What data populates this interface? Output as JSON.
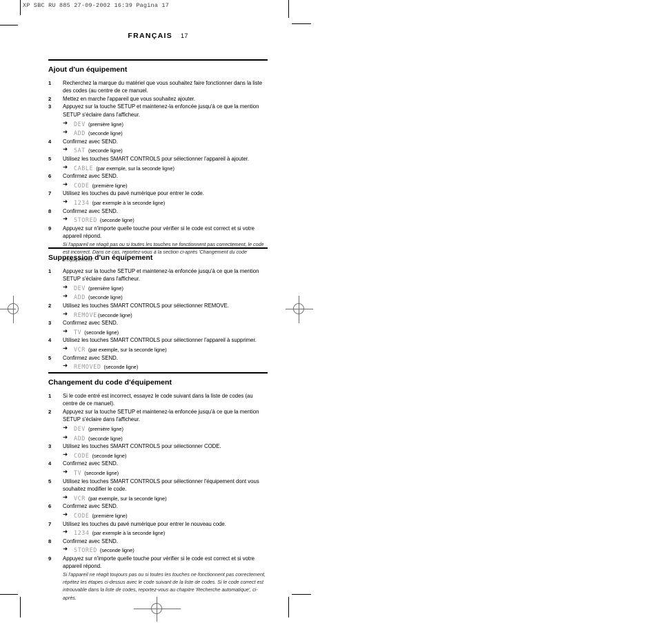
{
  "film_slug": "XP SBC RU 885  27-09-2002 16:39  Pagina 17",
  "running_head": {
    "language": "FRANÇAIS",
    "page_number": "17"
  },
  "sections": [
    {
      "id": "ajout",
      "title": "Ajout d'un équipement",
      "steps": [
        {
          "num": "1",
          "text": "Recherchez la marque du matériel que vous souhaitez faire fonctionner dans la liste des codes (au centre de ce manuel.",
          "lcd": []
        },
        {
          "num": "2",
          "text": "Mettez en marche l'appareil que vous souhaitez ajouter.",
          "lcd": []
        },
        {
          "num": "3",
          "text": "Appuyez sur la touche SETUP et maintenez-la enfoncée jusqu'à ce que la mention SETUP s'éclaire dans l'afficheur.",
          "lcd": [
            {
              "display": "DEV",
              "note": "(première ligne)"
            },
            {
              "display": "ADD",
              "note": "(seconde ligne)"
            }
          ]
        },
        {
          "num": "4",
          "text": "Confirmez avec SEND.",
          "lcd": [
            {
              "display": "SAT",
              "note": "(seconde ligne)"
            }
          ]
        },
        {
          "num": "5",
          "text": "Utilisez les touches SMART CONTROLS pour sélectionner l'appareil à ajouter.",
          "lcd": [
            {
              "display": "CABLE",
              "note": "(par exemple, sur la seconde ligne)"
            }
          ]
        },
        {
          "num": "6",
          "text": "Confirmez avec SEND.",
          "lcd": [
            {
              "display": "CODE",
              "note": "(première ligne)"
            }
          ]
        },
        {
          "num": "7",
          "text": "Utilisez les touches du pavé numérique pour entrer le code.",
          "lcd": [
            {
              "display": "1234",
              "note": "(par exemple à la seconde ligne)"
            }
          ]
        },
        {
          "num": "8",
          "text": "Confirmez avec SEND.",
          "lcd": [
            {
              "display": "STORED",
              "note": "(seconde ligne)"
            }
          ]
        },
        {
          "num": "9",
          "text": "Appuyez sur n'importe quelle touche pour vérifier si le code est correct et si votre appareil répond.",
          "lcd": [],
          "note": "Si l'appareil ne réagit pas ou si toutes les touches ne fonctionnent pas correctement, le code est incorrect. Dans ce cas, reportez-vous à la section ci-après 'Changement du code d'équipement'."
        }
      ]
    },
    {
      "id": "suppression",
      "title": "Suppression d'un équipement",
      "steps": [
        {
          "num": "1",
          "text": "Appuyez sur la touche SETUP et maintenez-la enfoncée jusqu'à ce que la mention SETUP s'éclaire dans l'afficheur.",
          "lcd": [
            {
              "display": "DEV",
              "note": "(première ligne)"
            },
            {
              "display": "ADD",
              "note": "(seconde ligne)"
            }
          ]
        },
        {
          "num": "2",
          "text": "Utilisez les touches SMART CONTROLS pour sélectionner REMOVE.",
          "lcd": [
            {
              "display": "REMOVE",
              "note": "(seconde ligne)",
              "tight": true
            }
          ]
        },
        {
          "num": "3",
          "text": "Confirmez avec SEND.",
          "lcd": [
            {
              "display": "TV",
              "note": "(seconde ligne)"
            }
          ]
        },
        {
          "num": "4",
          "text": "Utilisez les touches SMART CONTROLS pour sélectionner l'appareil à supprimer.",
          "lcd": [
            {
              "display": "VCR",
              "note": "(par exemple, sur la seconde ligne)"
            }
          ]
        },
        {
          "num": "5",
          "text": "Confirmez avec SEND.",
          "lcd": [
            {
              "display": "REMOVED",
              "note": "(seconde ligne)"
            }
          ]
        }
      ]
    },
    {
      "id": "changement",
      "title": "Changement du code d'équipement",
      "steps": [
        {
          "num": "1",
          "text": "Si le code entré est incorrect, essayez le code suivant dans la liste de codes (au centre de ce manuel).",
          "lcd": []
        },
        {
          "num": "2",
          "text": "Appuyez sur la touche SETUP et maintenez-la enfoncée jusqu'à ce que la mention SETUP s'éclaire dans l'afficheur.",
          "lcd": [
            {
              "display": "DEV",
              "note": "(première ligne)"
            },
            {
              "display": "ADD",
              "note": "(seconde ligne)"
            }
          ]
        },
        {
          "num": "3",
          "text": "Utilisez les touches SMART CONTROLS pour sélectionner CODE.",
          "lcd": [
            {
              "display": "CODE",
              "note": "(seconde ligne)"
            }
          ]
        },
        {
          "num": "4",
          "text": "Confirmez avec SEND.",
          "lcd": [
            {
              "display": "TV",
              "note": "(seconde ligne)"
            }
          ]
        },
        {
          "num": "5",
          "text": "Utilisez les touches SMART CONTROLS pour sélectionner l'équipement dont vous souhaitez modifier le code.",
          "lcd": [
            {
              "display": "VCR",
              "note": "(par exemple, sur la seconde ligne)"
            }
          ]
        },
        {
          "num": "6",
          "text": "Confirmez avec SEND.",
          "lcd": [
            {
              "display": "CODE",
              "note": "(première ligne)"
            }
          ]
        },
        {
          "num": "7",
          "text": "Utilisez les touches du pavé numérique pour entrer le nouveau code.",
          "lcd": [
            {
              "display": "1234",
              "note": "(par exemple à la seconde ligne)"
            }
          ]
        },
        {
          "num": "8",
          "text": "Confirmez avec SEND.",
          "lcd": [
            {
              "display": "STORED",
              "note": "(seconde ligne)"
            }
          ]
        },
        {
          "num": "9",
          "text": "Appuyez sur n'importe quelle touche pour vérifier si le code est correct et si votre appareil répond.",
          "lcd": [],
          "note": "Si l'appareil ne réagit toujours pas ou si toutes les touches ne fonctionnent pas correctement, répétez les étapes ci-dessus avec le code suivant de la liste de codes. Si le code correct est introuvable dans la liste de codes, reportez-vous au chapitre 'Recherche automatique', ci-après."
        }
      ]
    }
  ],
  "icons": {
    "arrow": "➜"
  }
}
